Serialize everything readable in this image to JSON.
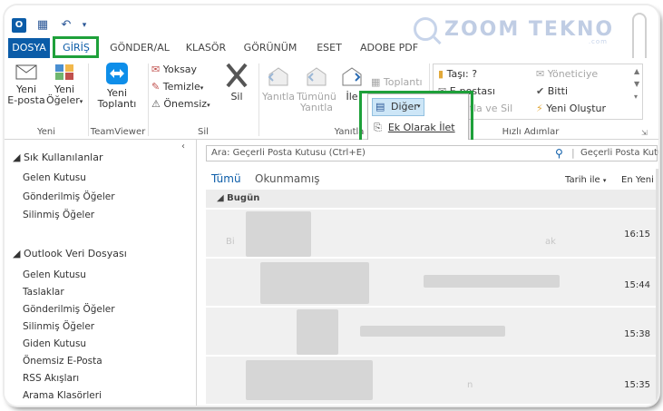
{
  "watermark": {
    "text": "ZOOM TEKNO",
    "sub": ".com"
  },
  "tabs": [
    {
      "label": "DOSYA"
    },
    {
      "label": "GİRİŞ"
    },
    {
      "label": "GÖNDER/AL"
    },
    {
      "label": "KLASÖR"
    },
    {
      "label": "GÖRÜNÜM"
    },
    {
      "label": "ESET"
    },
    {
      "label": "ADOBE PDF"
    }
  ],
  "ribbon": {
    "new_email_1": "Yeni",
    "new_email_2": "E-posta",
    "new_items_1": "Yeni",
    "new_items_2": "Öğeler",
    "new_group": "Yeni",
    "teamviewer_1": "Yeni",
    "teamviewer_2": "Toplantı",
    "teamviewer_group": "TeamViewer",
    "ignore": "Yoksay",
    "cleanup": "Temizle",
    "junk": "Önemsiz",
    "delete": "Sil",
    "delete_group": "Sil",
    "reply": "Yanıtla",
    "reply_all_1": "Tümünü",
    "reply_all_2": "Yanıtla",
    "forward": "İle",
    "respond_group": "Yanıtla",
    "meeting": "Toplantı",
    "more": "Diğer",
    "forward_attach": "Ek Olarak İlet",
    "qs_move": "Taşı: ?",
    "qs_email": "E-postası",
    "qs_reply_delete": "Yanıtla ve Sil",
    "qs_manager": "Yöneticiye",
    "qs_done": "Bitti",
    "qs_new": "Yeni Oluştur",
    "qs_group": "Hızlı Adımlar"
  },
  "folders": {
    "favorites": "Sık Kullanılanlar",
    "fav_items": [
      "Gelen Kutusu",
      "Gönderilmiş Öğeler",
      "Silinmiş Öğeler"
    ],
    "datafile": "Outlook Veri Dosyası",
    "data_items": [
      "Gelen Kutusu",
      "Taslaklar",
      "Gönderilmiş Öğeler",
      "Silinmiş Öğeler",
      "Giden Kutusu",
      "Önemsiz E-Posta",
      "RSS Akışları",
      "Arama Klasörleri"
    ]
  },
  "list": {
    "search_placeholder": "Ara: Geçerli Posta Kutusu (Ctrl+E)",
    "search_scope": "Geçerli Posta Kutusu",
    "filter_all": "Tümü",
    "filter_unread": "Okunmamış",
    "sort": "Tarih ile",
    "order": "En Yeni",
    "group": "Bugün",
    "messages": [
      {
        "time": "16:15"
      },
      {
        "time": "15:44"
      },
      {
        "time": "15:38"
      },
      {
        "time": "15:35"
      }
    ]
  }
}
